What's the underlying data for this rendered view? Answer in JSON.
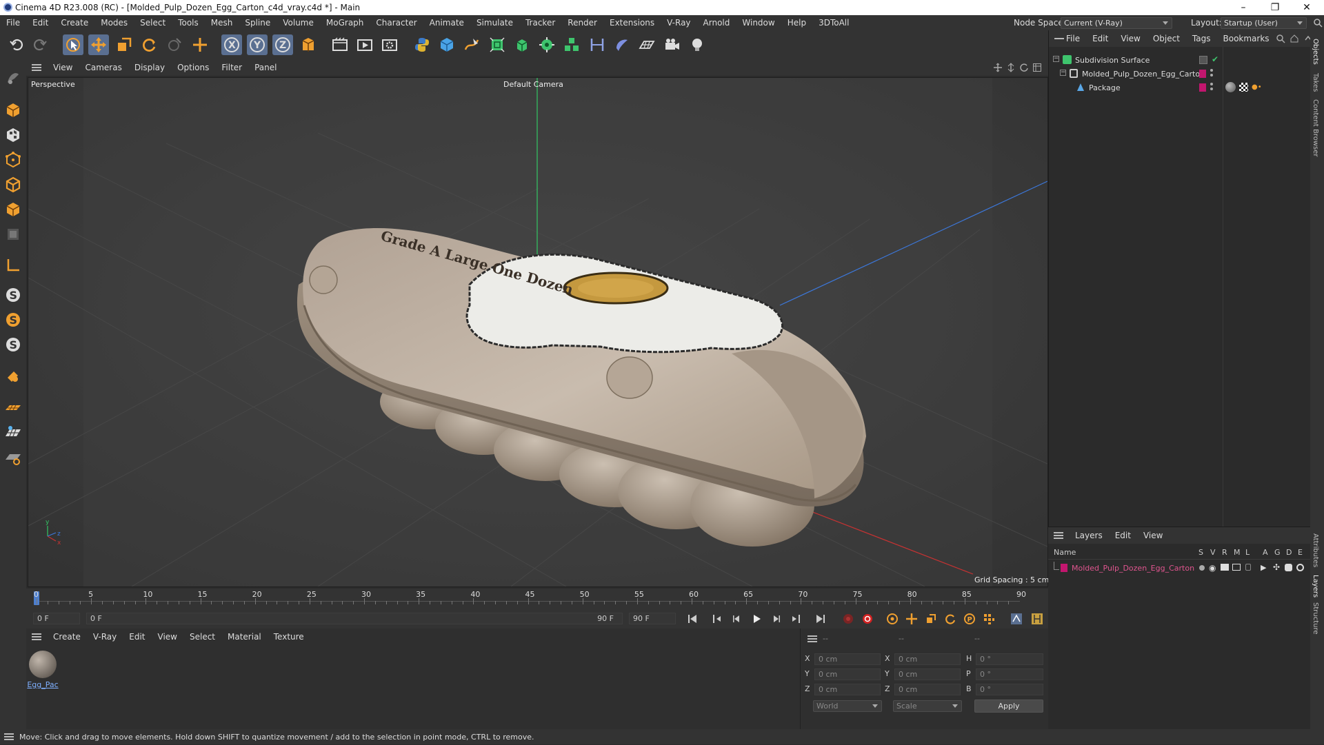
{
  "window": {
    "title": "Cinema 4D R23.008 (RC) - [Molded_Pulp_Dozen_Egg_Carton_c4d_vray.c4d *] - Main"
  },
  "menubar": {
    "items": [
      "File",
      "Edit",
      "Create",
      "Modes",
      "Select",
      "Tools",
      "Mesh",
      "Spline",
      "Volume",
      "MoGraph",
      "Character",
      "Animate",
      "Simulate",
      "Tracker",
      "Render",
      "Extensions",
      "V-Ray",
      "Arnold",
      "Window",
      "Help",
      "3DToAll"
    ],
    "node_space_label": "Node Space:",
    "node_space_value": "Current (V-Ray)",
    "layout_label": "Layout:",
    "layout_value": "Startup (User)"
  },
  "viewport": {
    "menu": [
      "View",
      "Cameras",
      "Display",
      "Options",
      "Filter",
      "Panel"
    ],
    "view_name": "Perspective",
    "camera": "Default Camera",
    "grid_spacing": "Grid Spacing : 5 cm",
    "carton_print": "Grade A Large One Dozen"
  },
  "timeline": {
    "ticks": [
      "0",
      "5",
      "10",
      "15",
      "20",
      "25",
      "30",
      "35",
      "40",
      "45",
      "50",
      "55",
      "60",
      "65",
      "70",
      "75",
      "80",
      "85",
      "90"
    ],
    "current_frame": "0 F",
    "start_frame": "0 F",
    "range_start": "0 F",
    "range_end": "90 F",
    "end_frame": "90 F",
    "right_frame": "0 F"
  },
  "material_manager": {
    "menu": [
      "Create",
      "V-Ray",
      "Edit",
      "View",
      "Select",
      "Material",
      "Texture"
    ],
    "materials": [
      {
        "name": "Egg_Pac"
      }
    ]
  },
  "attributes": {
    "header_left": "--",
    "header_mid": "--",
    "header_right": "--",
    "rows": [
      {
        "l1": "X",
        "v1": "0 cm",
        "l2": "X",
        "v2": "0 cm",
        "l3": "H",
        "v3": "0 °"
      },
      {
        "l1": "Y",
        "v1": "0 cm",
        "l2": "Y",
        "v2": "0 cm",
        "l3": "P",
        "v3": "0 °"
      },
      {
        "l1": "Z",
        "v1": "0 cm",
        "l2": "Z",
        "v2": "0 cm",
        "l3": "B",
        "v3": "0 °"
      }
    ],
    "coord_system": "World",
    "mode": "Scale",
    "apply_label": "Apply"
  },
  "object_manager": {
    "menu": [
      "File",
      "Edit",
      "View",
      "Object",
      "Tags",
      "Bookmarks"
    ],
    "objects": [
      {
        "name": "Subdivision Surface"
      },
      {
        "name": "Molded_Pulp_Dozen_Egg_Carton"
      },
      {
        "name": "Package"
      }
    ]
  },
  "layer_manager": {
    "menu": [
      "Layers",
      "Edit",
      "View"
    ],
    "col_name": "Name",
    "col_flags": [
      "S",
      "V",
      "R",
      "M",
      "L",
      "A",
      "G",
      "D",
      "E"
    ],
    "layers": [
      {
        "name": "Molded_Pulp_Dozen_Egg_Carton",
        "color": "#c2166e"
      }
    ]
  },
  "side_tabs": [
    "Objects",
    "Takes",
    "Content Browser",
    "Attributes",
    "Layers",
    "Structure"
  ],
  "status": {
    "text": "Move: Click and drag to move elements. Hold down SHIFT to quantize movement / add to the selection in point mode, CTRL to remove."
  },
  "colors": {
    "accent": "#5a6f91",
    "layer_color": "#c2166e",
    "x_axis": "#c83232",
    "y_axis": "#32c864",
    "z_axis": "#3c78dc"
  }
}
